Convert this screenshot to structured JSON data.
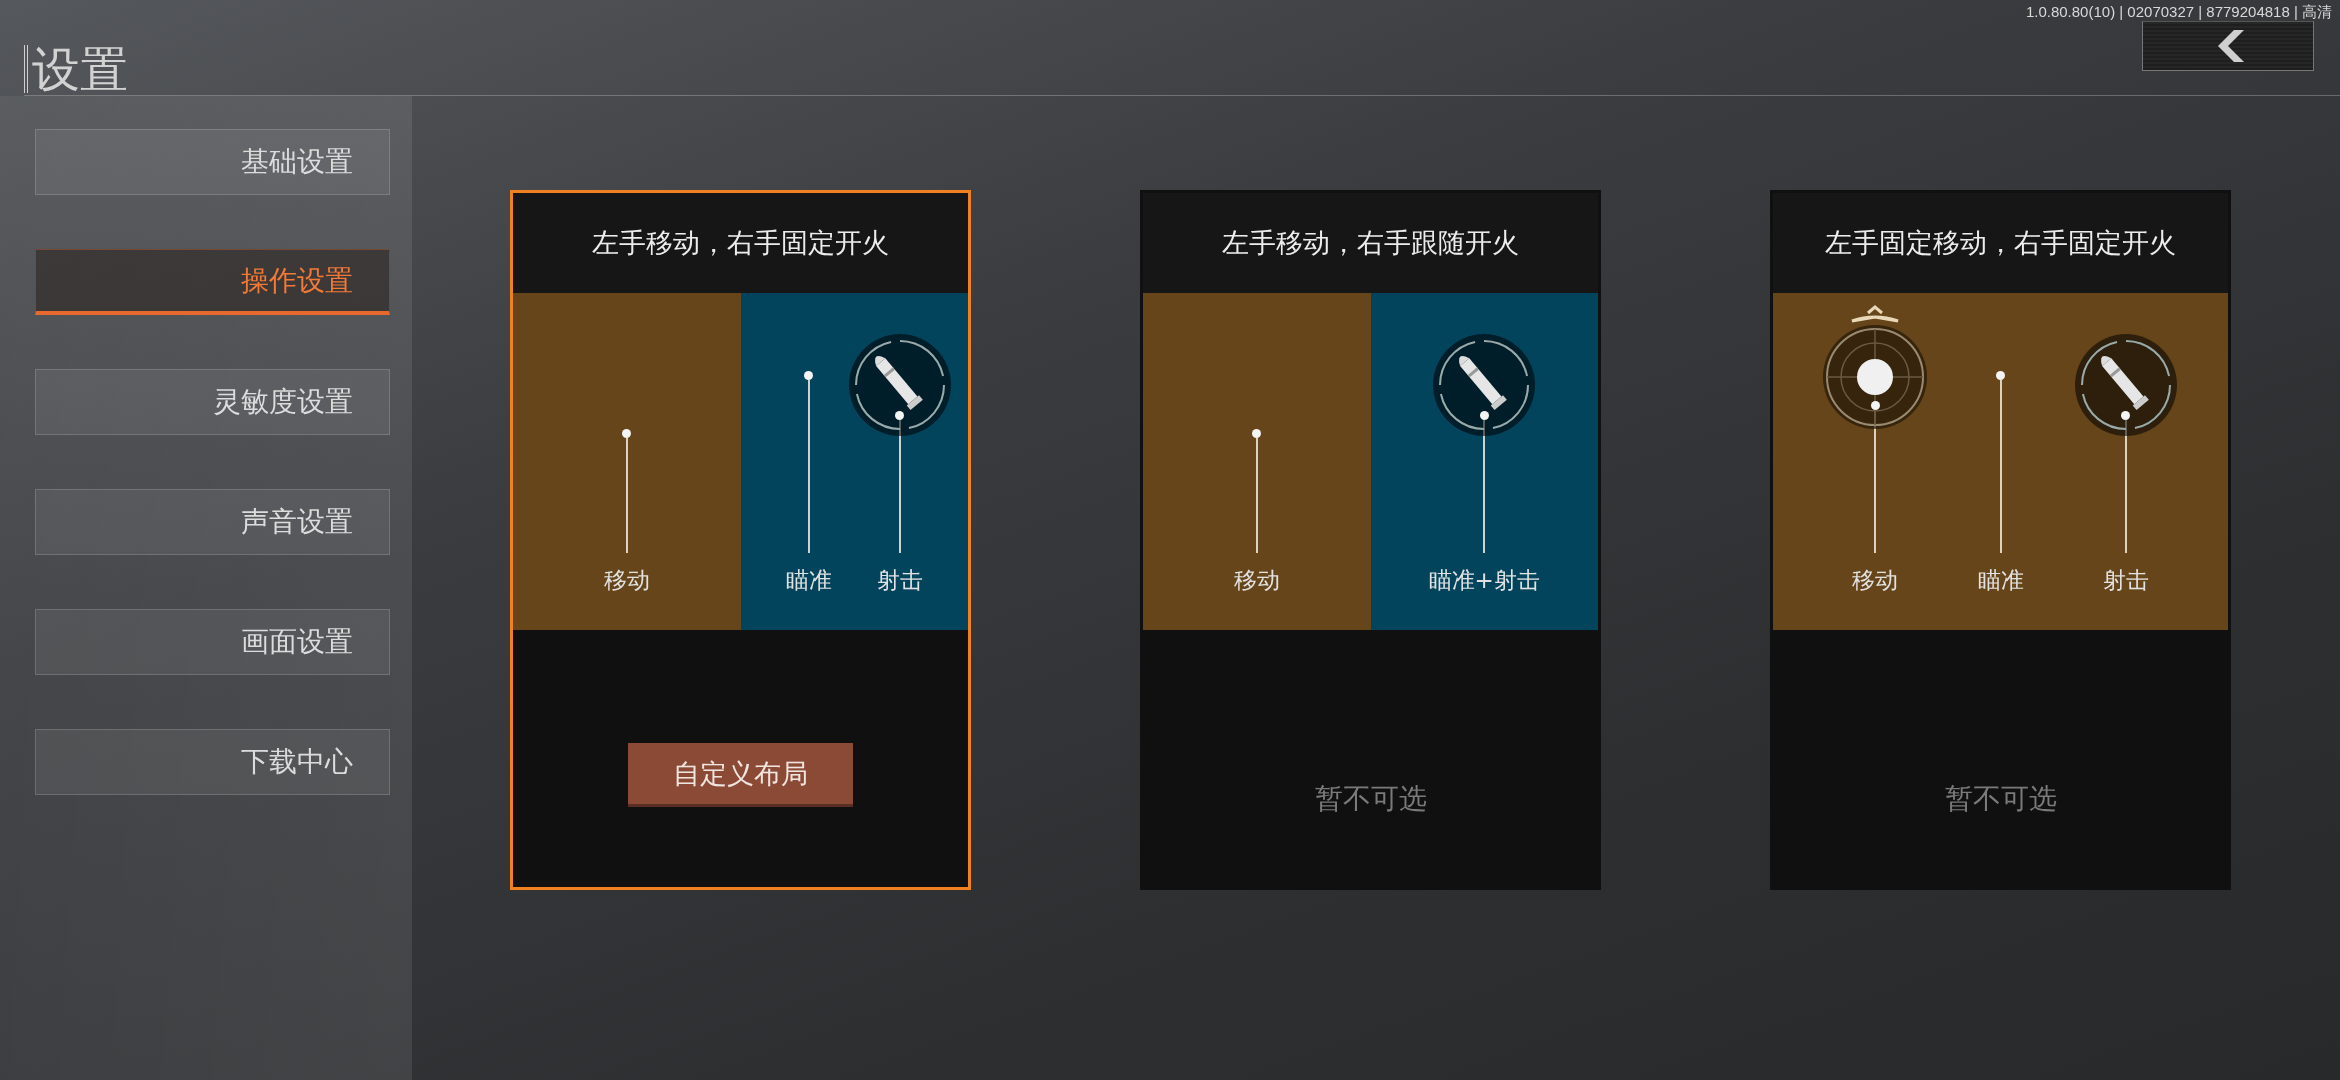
{
  "header": {
    "title": "设置",
    "version": "1.0.80.80(10) | 02070327 | 8779204818 | 高清"
  },
  "sidebar": {
    "items": [
      {
        "label": "基础设置",
        "selected": false
      },
      {
        "label": "操作设置",
        "selected": true
      },
      {
        "label": "灵敏度设置",
        "selected": false
      },
      {
        "label": "声音设置",
        "selected": false
      },
      {
        "label": "画面设置",
        "selected": false
      },
      {
        "label": "下载中心",
        "selected": false
      }
    ]
  },
  "cards": [
    {
      "title": "左手移动，右手固定开火",
      "selected": true,
      "zones": [
        {
          "color": "#654519",
          "controls": [
            {
              "label": "移动",
              "kind": "plain"
            }
          ]
        },
        {
          "color": "#02445c",
          "controls": [
            {
              "label": "瞄准",
              "kind": "plain"
            },
            {
              "label": "射击",
              "kind": "bullet"
            }
          ]
        }
      ],
      "footer": {
        "kind": "button",
        "label": "自定义布局"
      }
    },
    {
      "title": "左手移动，右手跟随开火",
      "selected": false,
      "zones": [
        {
          "color": "#654519",
          "controls": [
            {
              "label": "移动",
              "kind": "plain"
            }
          ]
        },
        {
          "color": "#02445c",
          "controls": [
            {
              "label": "瞄准+射击",
              "kind": "bullet"
            }
          ]
        }
      ],
      "footer": {
        "kind": "note",
        "label": "暂不可选"
      }
    },
    {
      "title": "左手固定移动，右手固定开火",
      "selected": false,
      "zones": [
        {
          "color": "#654519",
          "controls": [
            {
              "label": "移动",
              "kind": "joystick"
            },
            {
              "label": "瞄准",
              "kind": "plain"
            },
            {
              "label": "射击",
              "kind": "bullet"
            }
          ]
        }
      ],
      "footer": {
        "kind": "note",
        "label": "暂不可选"
      }
    }
  ]
}
